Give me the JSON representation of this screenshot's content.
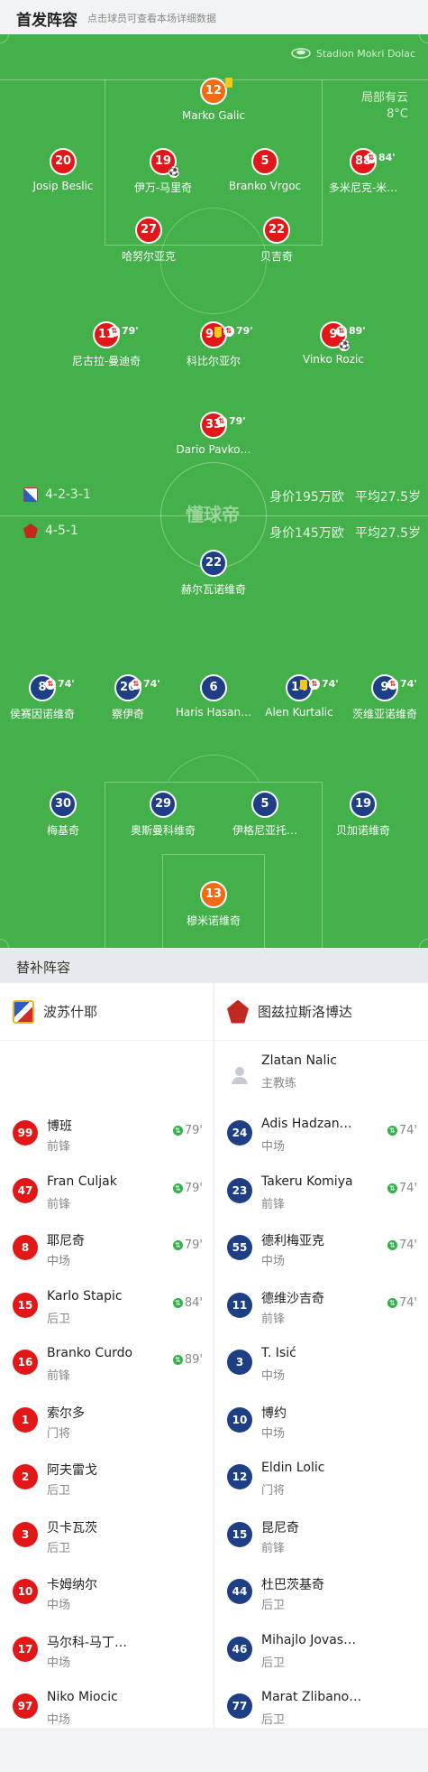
{
  "header": {
    "title": "首发阵容",
    "subtitle": "点击球员可查看本场详细数据"
  },
  "match": {
    "stadium": "Stadion Mokri Dolac",
    "weather": "局部有云",
    "temperature": "8°C"
  },
  "home_team": {
    "formation": "4-2-3-1",
    "value": "身价195万欧",
    "age": "平均27.5岁"
  },
  "away_team": {
    "formation": "4-5-1",
    "value": "身价145万欧",
    "age": "平均27.5岁"
  },
  "pitch_logo": "懂球帝",
  "home_lineup": [
    {
      "num": "12",
      "name": "Marko Galic",
      "color": "#f26b12",
      "yellow": true
    },
    {
      "num": "20",
      "name": "Josip Beslic"
    },
    {
      "num": "19",
      "name": "伊万-马里奇",
      "goal": true
    },
    {
      "num": "5",
      "name": "Branko Vrgoc"
    },
    {
      "num": "88",
      "name": "多米尼克-米…",
      "sub_min": "84'"
    },
    {
      "num": "27",
      "name": "哈努尔亚克"
    },
    {
      "num": "22",
      "name": "贝吉奇"
    },
    {
      "num": "11",
      "name": "尼古拉-曼迪奇",
      "sub_min": "79'"
    },
    {
      "num": "96",
      "name": "科比尔亚尔",
      "sub_min": "79'",
      "yellow": true
    },
    {
      "num": "9",
      "name": "Vinko Rozic",
      "sub_min": "89'",
      "goal": true
    },
    {
      "num": "33",
      "name": "Dario Pavko…",
      "sub_min": "79'"
    }
  ],
  "away_lineup": [
    {
      "num": "22",
      "name": "赫尔瓦诺维奇"
    },
    {
      "num": "8",
      "name": "侯赛因诺维奇",
      "sub_min": "74'"
    },
    {
      "num": "20",
      "name": "察伊奇",
      "sub_min": "74'"
    },
    {
      "num": "6",
      "name": "Haris Hasan…"
    },
    {
      "num": "14",
      "name": "Alen Kurtalic",
      "sub_min": "74'",
      "yellow": true
    },
    {
      "num": "9",
      "name": "茨维亚诺维奇",
      "sub_min": "74'"
    },
    {
      "num": "30",
      "name": "梅基奇"
    },
    {
      "num": "29",
      "name": "奥斯曼科维奇"
    },
    {
      "num": "5",
      "name": "伊格尼亚托…"
    },
    {
      "num": "19",
      "name": "贝加诺维奇"
    },
    {
      "num": "13",
      "name": "穆米诺维奇",
      "color": "#f26b12"
    }
  ],
  "substitutes": {
    "title": "替补阵容",
    "home_name": "波苏什耶",
    "away_name": "图兹拉斯洛博达",
    "coach": {
      "name": "Zlatan Nalic",
      "role": "主教练"
    },
    "home": [
      {
        "num": "99",
        "name": "博班",
        "pos": "前锋",
        "min": "79'"
      },
      {
        "num": "47",
        "name": "Fran Culjak",
        "pos": "前锋",
        "min": "79'"
      },
      {
        "num": "8",
        "name": "耶尼奇",
        "pos": "中场",
        "min": "79'"
      },
      {
        "num": "15",
        "name": "Karlo Stapic",
        "pos": "后卫",
        "min": "84'"
      },
      {
        "num": "16",
        "name": "Branko Curdo",
        "pos": "前锋",
        "min": "89'"
      },
      {
        "num": "1",
        "name": "索尔多",
        "pos": "门将"
      },
      {
        "num": "2",
        "name": "阿夫雷戈",
        "pos": "后卫"
      },
      {
        "num": "3",
        "name": "贝卡瓦茨",
        "pos": "后卫"
      },
      {
        "num": "10",
        "name": "卡姆纳尔",
        "pos": "中场"
      },
      {
        "num": "17",
        "name": "马尔科-马丁…",
        "pos": "中场"
      },
      {
        "num": "97",
        "name": "Niko Miocic",
        "pos": "中场"
      }
    ],
    "away": [
      {
        "num": "24",
        "name": "Adis Hadzan…",
        "pos": "中场",
        "min": "74'"
      },
      {
        "num": "23",
        "name": "Takeru Komiya",
        "pos": "前锋",
        "min": "74'"
      },
      {
        "num": "55",
        "name": "德利梅亚克",
        "pos": "中场",
        "min": "74'"
      },
      {
        "num": "11",
        "name": "德维沙吉奇",
        "pos": "前锋",
        "min": "74'"
      },
      {
        "num": "3",
        "name": "T. Isić",
        "pos": "中场"
      },
      {
        "num": "10",
        "name": "博约",
        "pos": "中场"
      },
      {
        "num": "12",
        "name": "Eldin Lolic",
        "pos": "门将"
      },
      {
        "num": "15",
        "name": "昆尼奇",
        "pos": "前锋"
      },
      {
        "num": "44",
        "name": "杜巴茨基奇",
        "pos": "后卫"
      },
      {
        "num": "46",
        "name": "Mihajlo Jovas…",
        "pos": "后卫"
      },
      {
        "num": "77",
        "name": "Marat Zlibano…",
        "pos": "后卫"
      }
    ]
  }
}
